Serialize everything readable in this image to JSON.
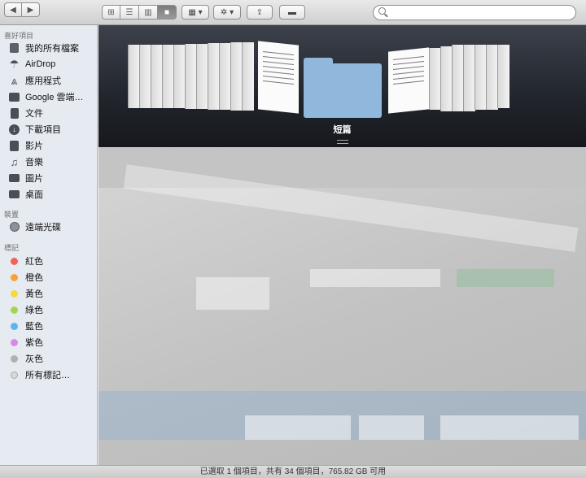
{
  "sidebar": {
    "favorites_header": "喜好項目",
    "favorites": [
      {
        "label": "我的所有檔案",
        "icon": "all-files-icon"
      },
      {
        "label": "AirDrop",
        "icon": "airdrop-icon"
      },
      {
        "label": "應用程式",
        "icon": "applications-icon"
      },
      {
        "label": "Google 雲端…",
        "icon": "folder-icon"
      },
      {
        "label": "文件",
        "icon": "documents-icon"
      },
      {
        "label": "下載項目",
        "icon": "downloads-icon"
      },
      {
        "label": "影片",
        "icon": "movies-icon"
      },
      {
        "label": "音樂",
        "icon": "music-icon"
      },
      {
        "label": "圖片",
        "icon": "pictures-icon"
      },
      {
        "label": "桌面",
        "icon": "desktop-icon"
      }
    ],
    "devices_header": "裝置",
    "devices": [
      {
        "label": "遠端光碟",
        "icon": "remote-disc-icon"
      }
    ],
    "tags_header": "標記",
    "tags": [
      {
        "label": "紅色",
        "color": "#f0625d"
      },
      {
        "label": "橙色",
        "color": "#f7a13a"
      },
      {
        "label": "黃色",
        "color": "#f5d93f"
      },
      {
        "label": "綠色",
        "color": "#a2d64f"
      },
      {
        "label": "藍色",
        "color": "#5eb3f1"
      },
      {
        "label": "紫色",
        "color": "#d88ae8"
      },
      {
        "label": "灰色",
        "color": "#b0b0b0"
      },
      {
        "label": "所有標記…",
        "color": "#d8d8d8"
      }
    ]
  },
  "search": {
    "placeholder": "",
    "value": ""
  },
  "coverflow": {
    "selected_title": "短篇"
  },
  "status": {
    "text": "已選取 1 個項目，共有 34 個項目，765.82 GB 可用"
  },
  "colors": {
    "folder": "#8fb8dc",
    "coverflow_bg": "#2a2e36",
    "sidebar_bg": "#e6ebf1"
  }
}
